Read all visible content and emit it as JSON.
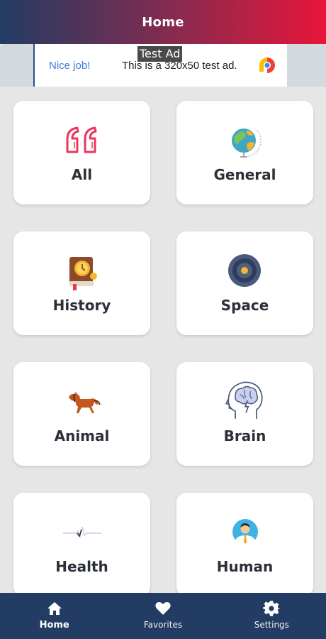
{
  "header": {
    "title": "Home"
  },
  "ad": {
    "badge": "Test Ad",
    "left_text": "Nice job!",
    "body_text": "This is a 320x50 test ad."
  },
  "categories": [
    {
      "label": "All",
      "icon": "quote-icon"
    },
    {
      "label": "General",
      "icon": "globe-icon"
    },
    {
      "label": "History",
      "icon": "history-book-icon"
    },
    {
      "label": "Space",
      "icon": "space-planet-icon"
    },
    {
      "label": "Animal",
      "icon": "horse-icon"
    },
    {
      "label": "Brain",
      "icon": "brain-head-icon"
    },
    {
      "label": "Health",
      "icon": "heartbeat-icon"
    },
    {
      "label": "Human",
      "icon": "person-avatar-icon"
    }
  ],
  "nav": {
    "items": [
      {
        "label": "Home",
        "icon": "home-icon",
        "active": true
      },
      {
        "label": "Favorites",
        "icon": "heart-icon",
        "active": false
      },
      {
        "label": "Settings",
        "icon": "gear-icon",
        "active": false
      }
    ]
  },
  "colors": {
    "header_gradient_start": "#223c64",
    "header_gradient_end": "#e8153a",
    "nav_background": "#223c64",
    "card_background": "#ffffff",
    "page_background": "#e6e6e6"
  }
}
